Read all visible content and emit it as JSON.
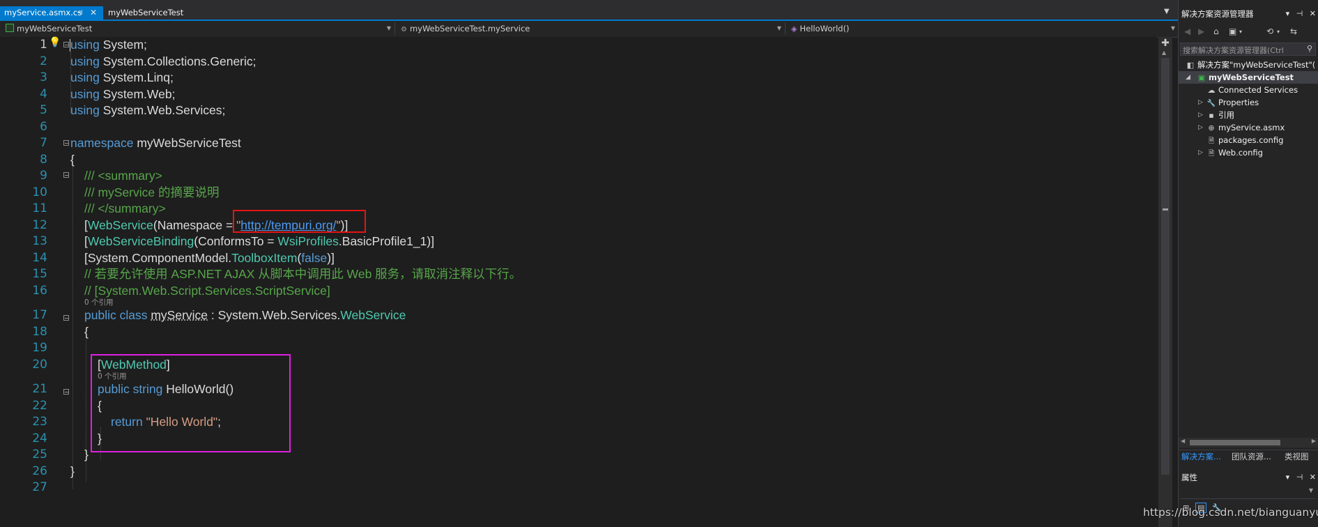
{
  "tabs": [
    {
      "label": "myService.asmx.cs",
      "pin": "⊣",
      "close": "✕"
    },
    {
      "label": "myWebServiceTest"
    }
  ],
  "navbar": {
    "project": "myWebServiceTest",
    "class_scope": "myWebServiceTest.myService",
    "member": "HelloWorld()"
  },
  "line_numbers": [
    "1",
    "2",
    "3",
    "4",
    "5",
    "6",
    "7",
    "8",
    "9",
    "10",
    "11",
    "12",
    "13",
    "14",
    "15",
    "16",
    "17",
    "18",
    "19",
    "20",
    "21",
    "22",
    "23",
    "24",
    "25",
    "26",
    "27"
  ],
  "code": {
    "l1": [
      "using",
      " System;"
    ],
    "l2": [
      "using",
      " System.Collections.Generic;"
    ],
    "l3": [
      "using",
      " System.Linq;"
    ],
    "l4": [
      "using",
      " System.Web;"
    ],
    "l5": [
      "using",
      " System.Web.Services;"
    ],
    "l7": [
      "namespace",
      " myWebServiceTest"
    ],
    "l8": "{",
    "l9": "/// <summary>",
    "l10": "/// myService 的摘要说明",
    "l11": "/// </summary>",
    "l12": [
      "[",
      "WebService",
      "(Namespace = ",
      "\"",
      "http://tempuri.org/",
      "\"",
      ")]"
    ],
    "l13": [
      "[",
      "WebServiceBinding",
      "(ConformsTo = ",
      "WsiProfiles",
      ".BasicProfile1_1)]"
    ],
    "l14": [
      "[System.ComponentModel.",
      "ToolboxItem",
      "(",
      "false",
      ")]"
    ],
    "l15": "// 若要允许使用 ASP.NET AJAX 从脚本中调用此 Web 服务，请取消注释以下行。",
    "l16": "// [System.Web.Script.Services.ScriptService]",
    "lens17": "0 个引用",
    "l17": [
      "public",
      " ",
      "class",
      " ",
      "myService",
      " : System.Web.Services.",
      "WebService"
    ],
    "l18": "{",
    "l20": [
      "[",
      "WebMethod",
      "]"
    ],
    "lens21": "0 个引用",
    "l21": [
      "public",
      " ",
      "string",
      " HelloWorld()"
    ],
    "l22": "{",
    "l23": [
      "return",
      " ",
      "\"Hello World\"",
      ";"
    ],
    "l24": "}",
    "l25": "}",
    "l26": "}"
  },
  "solution_explorer": {
    "title": "解决方案资源管理器",
    "title_buttons": "▾ ⊣ ✕",
    "search_placeholder": "搜索解决方案资源管理器(Ctrl",
    "toolbar": [
      "◀",
      "▶",
      "⌂",
      "▣",
      "▾",
      "⟲",
      "▾",
      "⇆"
    ],
    "items": [
      {
        "label": "解决方案\"myWebServiceTest\"(",
        "icon": "solution-icon",
        "glyph": "◧"
      },
      {
        "label": "myWebServiceTest",
        "icon": "project-icon",
        "glyph": "▣"
      },
      {
        "label": "Connected Services",
        "icon": "cloud-icon",
        "glyph": "☁"
      },
      {
        "label": "Properties",
        "icon": "wrench-icon",
        "glyph": "🔧"
      },
      {
        "label": "引用",
        "icon": "references-icon",
        "glyph": "▪"
      },
      {
        "label": "myService.asmx",
        "icon": "web-icon",
        "glyph": "⊕"
      },
      {
        "label": "packages.config",
        "icon": "config-icon",
        "glyph": "🗎"
      },
      {
        "label": "Web.config",
        "icon": "config-icon",
        "glyph": "🗎"
      }
    ],
    "bottom_tabs": [
      "解决方案...",
      "团队资源...",
      "类视图"
    ]
  },
  "properties": {
    "title": "属性",
    "title_buttons": "▾ ⊣ ✕",
    "toolbar": [
      "⊞",
      "▤",
      "🔧"
    ]
  },
  "watermark": "https://blog.csdn.net/bianguanyue",
  "colors": {
    "accent": "#007acc",
    "keyword": "#569cd6",
    "type": "#4ec9b0",
    "comment": "#57a64a",
    "string": "#d69d85",
    "line_number": "#2b91af",
    "highlight_red": "#e51414",
    "highlight_magenta": "#e020e0"
  }
}
